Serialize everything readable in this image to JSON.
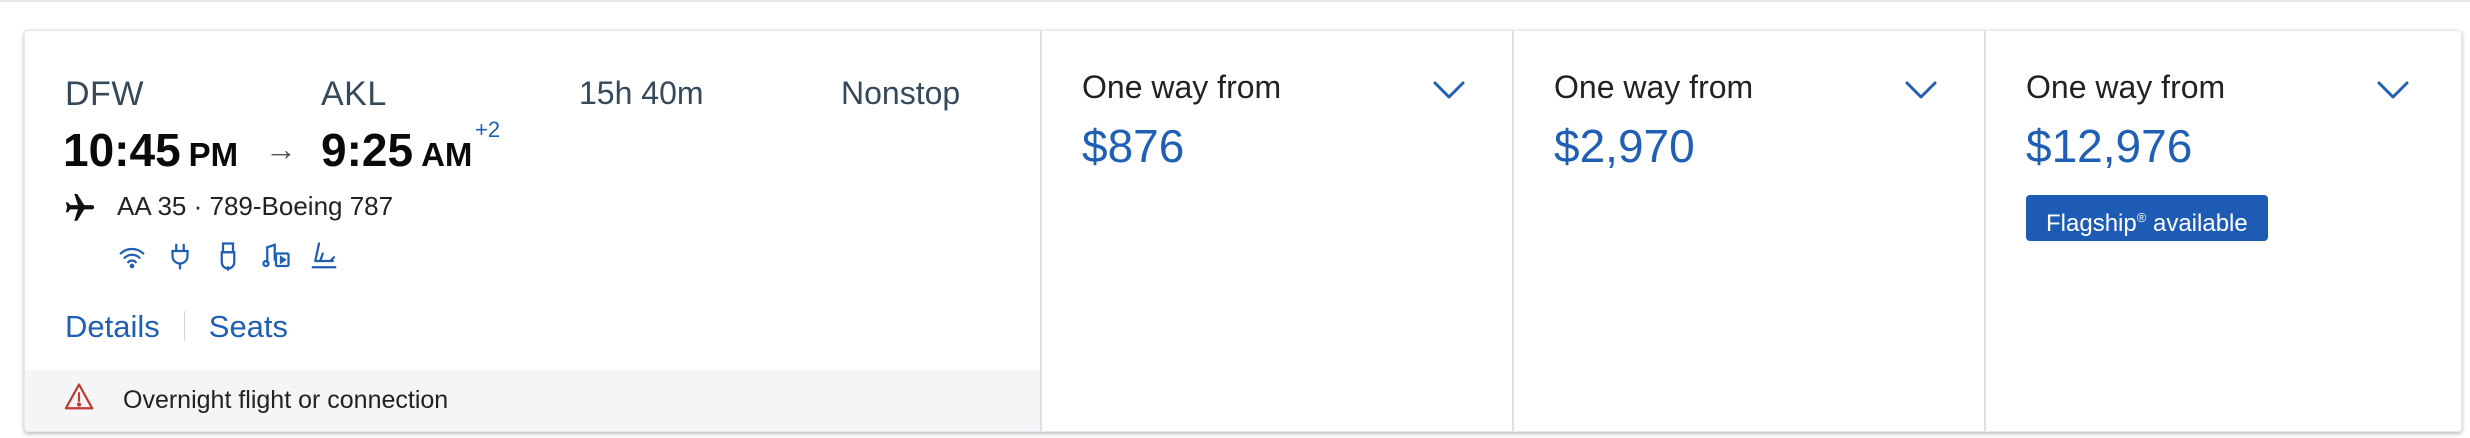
{
  "flight": {
    "origin_code": "DFW",
    "destination_code": "AKL",
    "departure_time": "10:45",
    "departure_ampm": "PM",
    "arrival_time": "9:25",
    "arrival_ampm": "AM",
    "arrival_day_offset": "+2",
    "duration": "15h 40m",
    "stops": "Nonstop",
    "flight_info": "AA 35 · 789-Boeing 787",
    "amenities": [
      "wifi-icon",
      "power-outlet-icon",
      "usb-icon",
      "entertainment-icon",
      "lie-flat-seat-icon"
    ]
  },
  "links": {
    "details": "Details",
    "seats": "Seats"
  },
  "notice": {
    "text": "Overnight flight or connection"
  },
  "fares": [
    {
      "label": "One way from",
      "price": "$876"
    },
    {
      "label": "One way from",
      "price": "$2,970"
    },
    {
      "label": "One way from",
      "price": "$12,976",
      "badge": "Flagship",
      "badge_mark": "®",
      "badge_suffix": " available"
    }
  ],
  "colors": {
    "link": "#1f5fb5",
    "badge_bg": "#1d5bb4",
    "notice_bg": "#f4f5f6",
    "warning": "#c0392b"
  }
}
